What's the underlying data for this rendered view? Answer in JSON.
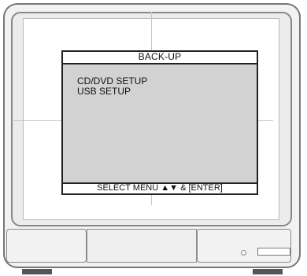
{
  "osd": {
    "title": "BACK-UP",
    "menu_items": [
      {
        "label": "CD/DVD SETUP"
      },
      {
        "label": "USB SETUP"
      }
    ],
    "footer": "SELECT MENU ▲▼ & [ENTER]"
  },
  "colors": {
    "osd_background": "#d2d2d2",
    "border": "#222222"
  }
}
